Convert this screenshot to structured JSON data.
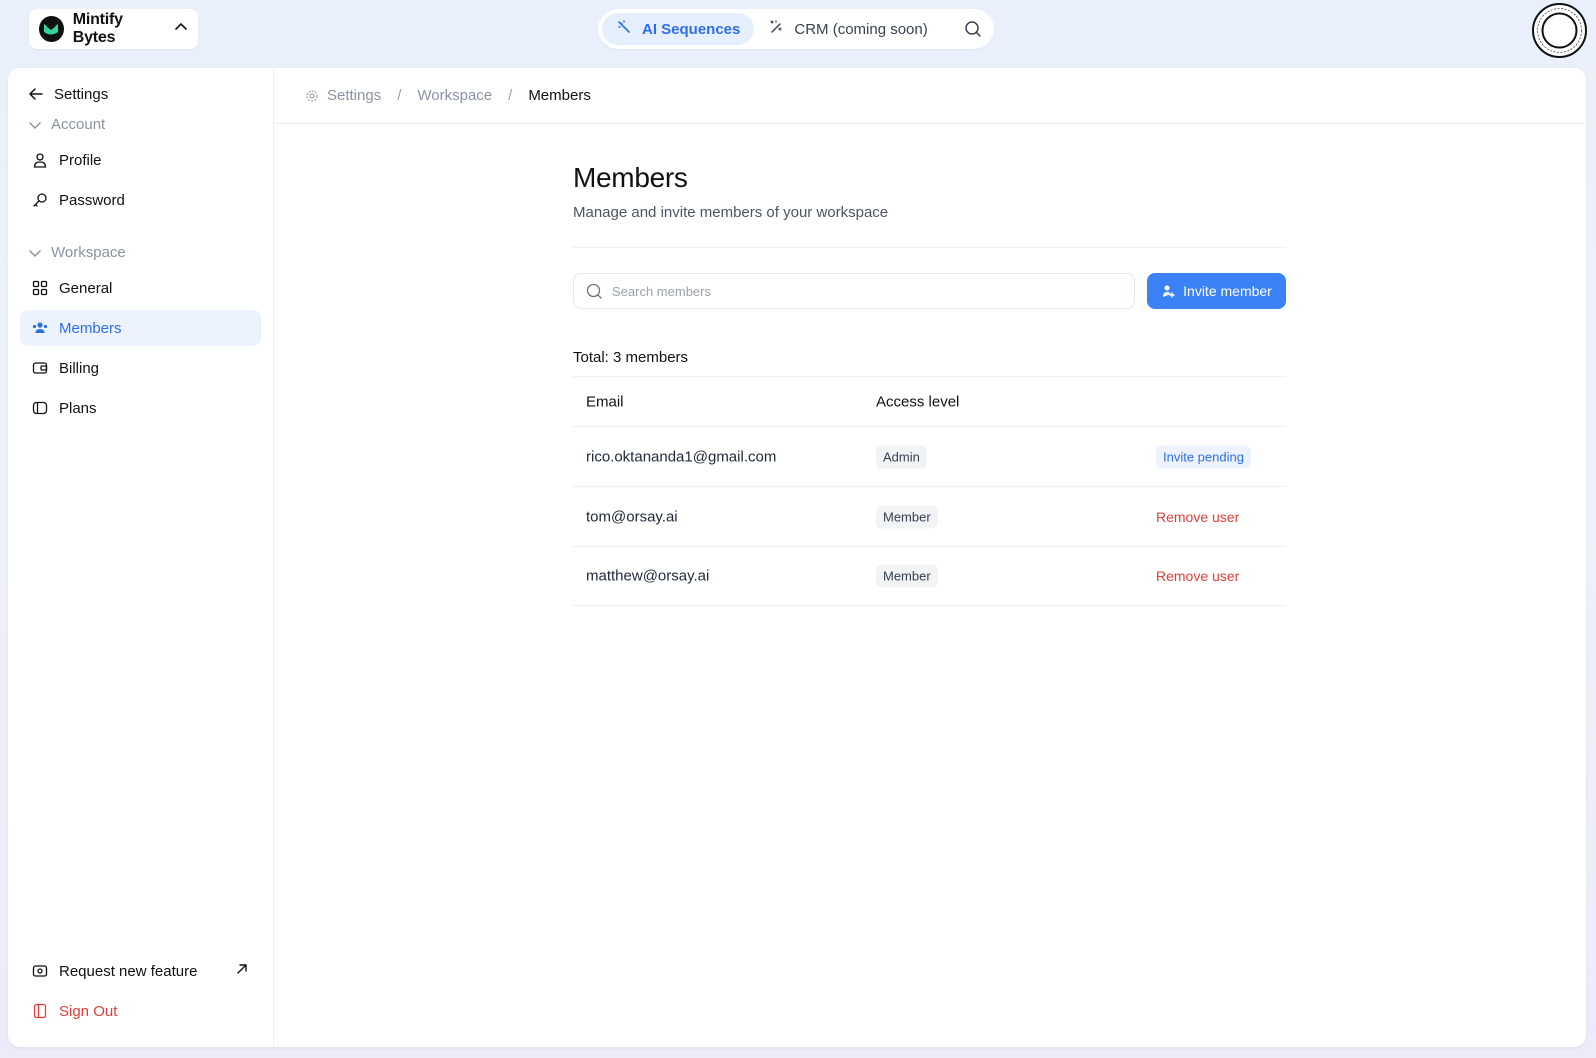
{
  "topbar": {
    "workspace_name": "Mintify Bytes",
    "tabs": [
      {
        "label": "AI Sequences",
        "icon": "magic-wand-icon"
      },
      {
        "label": "CRM (coming soon)",
        "icon": "sparkle-wand-icon"
      }
    ]
  },
  "sidebar": {
    "back_label": "Settings",
    "account_section": "Account",
    "account_items": [
      {
        "label": "Profile",
        "icon": "user-icon"
      },
      {
        "label": "Password",
        "icon": "key-icon"
      }
    ],
    "workspace_section": "Workspace",
    "workspace_items": [
      {
        "label": "General",
        "icon": "grid-icon"
      },
      {
        "label": "Members",
        "icon": "users-icon"
      },
      {
        "label": "Billing",
        "icon": "wallet-icon"
      },
      {
        "label": "Plans",
        "icon": "tag-icon"
      }
    ],
    "request_feature": "Request new feature",
    "sign_out": "Sign Out"
  },
  "breadcrumb": [
    "Settings",
    "Workspace",
    "Members"
  ],
  "main": {
    "title": "Members",
    "subtitle": "Manage and invite members of your workspace",
    "search_placeholder": "Search members",
    "invite_label": "Invite member",
    "total": "Total: 3 members",
    "columns": [
      "Email",
      "Access level"
    ],
    "rows": [
      {
        "email": "rico.oktananda1@gmail.com",
        "access": "Admin",
        "action": "Invite pending",
        "action_type": "pending"
      },
      {
        "email": "tom@orsay.ai",
        "access": "Member",
        "action": "Remove user",
        "action_type": "remove"
      },
      {
        "email": "matthew@orsay.ai",
        "access": "Member",
        "action": "Remove user",
        "action_type": "remove"
      }
    ]
  },
  "colors": {
    "accent": "#3b82f6",
    "accent_text": "#2f6fe4",
    "danger": "#e03e3e"
  }
}
